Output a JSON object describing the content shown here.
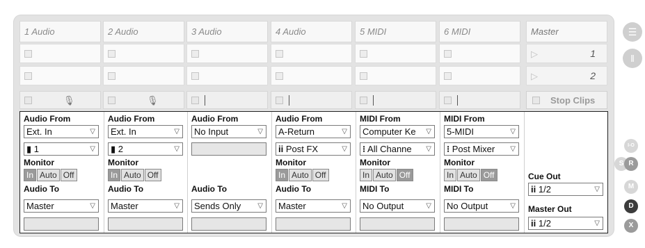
{
  "tracks": [
    {
      "name": "1 Audio",
      "rec": "mic-icon",
      "from_label": "Audio From",
      "from_value": "Ext. In",
      "channel": "1",
      "monitor_label": "Monitor",
      "to_label": "Audio To",
      "to_value": "Master"
    },
    {
      "name": "2 Audio",
      "rec": "mic-icon",
      "from_label": "Audio From",
      "from_value": "Ext. In",
      "channel": "2",
      "monitor_label": "Monitor",
      "to_label": "Audio To",
      "to_value": "Master"
    },
    {
      "name": "3 Audio",
      "rec": "caret",
      "from_label": "Audio From",
      "from_value": "No Input",
      "channel": "",
      "monitor_label": "",
      "to_label": "Audio To",
      "to_value": "Sends Only"
    },
    {
      "name": "4 Audio",
      "rec": "caret",
      "from_label": "Audio From",
      "from_value": "A-Return",
      "channel": "Post FX",
      "monitor_label": "Monitor",
      "to_label": "Audio To",
      "to_value": "Master"
    },
    {
      "name": "5 MIDI",
      "rec": "caret",
      "from_label": "MIDI From",
      "from_value": "Computer Ke",
      "channel": "All Channe",
      "monitor_label": "Monitor",
      "to_label": "MIDI To",
      "to_value": "No Output"
    },
    {
      "name": "6 MIDI",
      "rec": "caret",
      "from_label": "MIDI From",
      "from_value": "5-MIDI",
      "channel": "Post Mixer",
      "monitor_label": "Monitor",
      "to_label": "MIDI To",
      "to_value": "No Output"
    }
  ],
  "monitor_buttons": [
    "In",
    "Auto",
    "Off"
  ],
  "master": {
    "name": "Master",
    "scenes": [
      "1",
      "2"
    ],
    "stop_clips": "Stop Clips",
    "cue_label": "Cue Out",
    "cue_value": "1/2",
    "master_label": "Master Out",
    "master_value": "1/2"
  },
  "side_buttons": [
    "I-O",
    "S",
    "R",
    "M",
    "D",
    "X"
  ],
  "chain_glyph": "ii",
  "bar_glyph": "▮",
  "dot_glyph": "⁝",
  "arrow_glyph": "▽",
  "play_glyph": "▷",
  "mic_glyph": "🎙"
}
